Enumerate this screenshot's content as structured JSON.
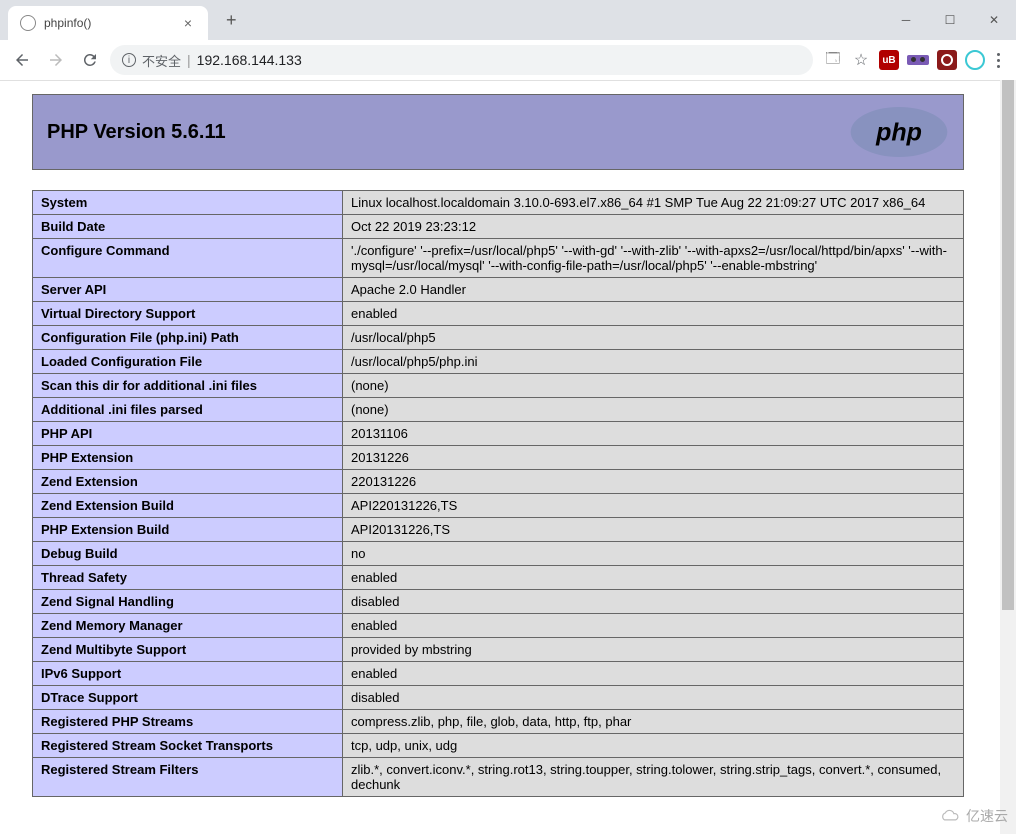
{
  "browser": {
    "tab_title": "phpinfo()",
    "insecure_label": "不安全",
    "url": "192.168.144.133"
  },
  "header": {
    "title": "PHP Version 5.6.11"
  },
  "rows": [
    {
      "key": "System",
      "val": "Linux localhost.localdomain 3.10.0-693.el7.x86_64 #1 SMP Tue Aug 22 21:09:27 UTC 2017 x86_64"
    },
    {
      "key": "Build Date",
      "val": "Oct 22 2019 23:23:12"
    },
    {
      "key": "Configure Command",
      "val": "'./configure' '--prefix=/usr/local/php5' '--with-gd' '--with-zlib' '--with-apxs2=/usr/local/httpd/bin/apxs' '--with-mysql=/usr/local/mysql' '--with-config-file-path=/usr/local/php5' '--enable-mbstring'"
    },
    {
      "key": "Server API",
      "val": "Apache 2.0 Handler"
    },
    {
      "key": "Virtual Directory Support",
      "val": "enabled"
    },
    {
      "key": "Configuration File (php.ini) Path",
      "val": "/usr/local/php5"
    },
    {
      "key": "Loaded Configuration File",
      "val": "/usr/local/php5/php.ini"
    },
    {
      "key": "Scan this dir for additional .ini files",
      "val": "(none)"
    },
    {
      "key": "Additional .ini files parsed",
      "val": "(none)"
    },
    {
      "key": "PHP API",
      "val": "20131106"
    },
    {
      "key": "PHP Extension",
      "val": "20131226"
    },
    {
      "key": "Zend Extension",
      "val": "220131226"
    },
    {
      "key": "Zend Extension Build",
      "val": "API220131226,TS"
    },
    {
      "key": "PHP Extension Build",
      "val": "API20131226,TS"
    },
    {
      "key": "Debug Build",
      "val": "no"
    },
    {
      "key": "Thread Safety",
      "val": "enabled"
    },
    {
      "key": "Zend Signal Handling",
      "val": "disabled"
    },
    {
      "key": "Zend Memory Manager",
      "val": "enabled"
    },
    {
      "key": "Zend Multibyte Support",
      "val": "provided by mbstring"
    },
    {
      "key": "IPv6 Support",
      "val": "enabled"
    },
    {
      "key": "DTrace Support",
      "val": "disabled"
    },
    {
      "key": "Registered PHP Streams",
      "val": "compress.zlib, php, file, glob, data, http, ftp, phar"
    },
    {
      "key": "Registered Stream Socket Transports",
      "val": "tcp, udp, unix, udg"
    },
    {
      "key": "Registered Stream Filters",
      "val": "zlib.*, convert.iconv.*, string.rot13, string.toupper, string.tolower, string.strip_tags, convert.*, consumed, dechunk"
    }
  ],
  "watermark": "亿速云"
}
